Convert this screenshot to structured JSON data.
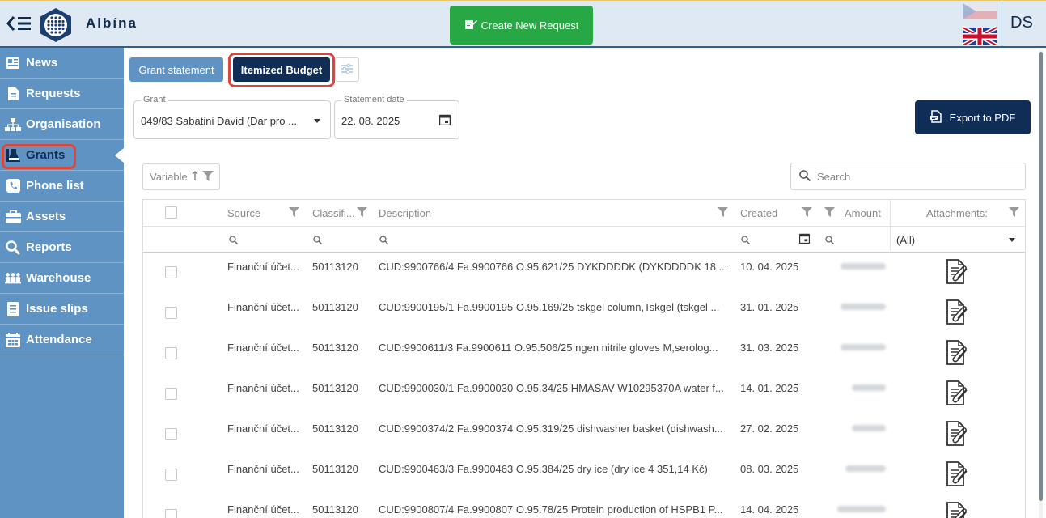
{
  "app": {
    "brand": "Albína",
    "user_initials": "DS"
  },
  "toolbar": {
    "create_label": "Create New Request"
  },
  "sidebar": {
    "items": [
      {
        "label": "News",
        "icon": "newspaper-icon"
      },
      {
        "label": "Requests",
        "icon": "document-icon"
      },
      {
        "label": "Organisation",
        "icon": "org-chart-icon"
      },
      {
        "label": "Grants",
        "icon": "flask-icon",
        "active": true
      },
      {
        "label": "Phone list",
        "icon": "phone-icon"
      },
      {
        "label": "Assets",
        "icon": "briefcase-icon"
      },
      {
        "label": "Reports",
        "icon": "search-icon"
      },
      {
        "label": "Warehouse",
        "icon": "people-icon"
      },
      {
        "label": "Issue slips",
        "icon": "list-icon"
      },
      {
        "label": "Attendance",
        "icon": "calendar-icon"
      }
    ]
  },
  "tabs": {
    "grant_statement": "Grant statement",
    "itemized_budget": "Itemized Budget"
  },
  "filters": {
    "grant_label": "Grant",
    "grant_value": "049/83 Sabatini David (Dar pro ...",
    "date_label": "Statement date",
    "date_value": "22. 08. 2025"
  },
  "export_label": "Export to PDF",
  "grid": {
    "variable_label": "Variable",
    "search_placeholder": "Search",
    "columns": {
      "source": "Source",
      "classification": "Classifi...",
      "description": "Description",
      "created": "Created",
      "amount": "Amount",
      "attachments": "Attachments:"
    },
    "attachments_filter": "(All)",
    "rows": [
      {
        "source": "Finanční účet...",
        "classification": "50113120",
        "description": "CUD:9900766/4 Fa.9900766 O.95.621/25 DYKDDDDK (DYKDDDDK 18 ...",
        "created": "10. 04. 2025"
      },
      {
        "source": "Finanční účet...",
        "classification": "50113120",
        "description": "CUD:9900195/1 Fa.9900195 O.95.169/25 tskgel column,Tskgel (tskgel ...",
        "created": "31. 01. 2025"
      },
      {
        "source": "Finanční účet...",
        "classification": "50113120",
        "description": "CUD:9900611/3 Fa.9900611 O.95.506/25 ngen nitrile gloves M,serolog...",
        "created": "31. 03. 2025"
      },
      {
        "source": "Finanční účet...",
        "classification": "50113120",
        "description": "CUD:9900030/1 Fa.9900030 O.95.34/25 HMASAV W10295370A water f...",
        "created": "14. 01. 2025"
      },
      {
        "source": "Finanční účet...",
        "classification": "50113120",
        "description": "CUD:9900374/2 Fa.9900374 O.95.319/25 dishwasher basket (dishwash...",
        "created": "27. 02. 2025"
      },
      {
        "source": "Finanční účet...",
        "classification": "50113120",
        "description": "CUD:9900463/3 Fa.9900463 O.95.384/25 dry ice (dry ice 4 351,14 Kč)",
        "created": "08. 03. 2025"
      },
      {
        "source": "Finanční účet...",
        "classification": "50113120",
        "description": "CUD:9900807/4 Fa.9900807 O.95.78/25 Protein production of HSPB1 P...",
        "created": "14. 04. 2025"
      }
    ]
  },
  "colors": {
    "sidebar": "#5f93c4",
    "navy": "#0f2d55",
    "green": "#28a745",
    "highlight": "#d9473c"
  }
}
